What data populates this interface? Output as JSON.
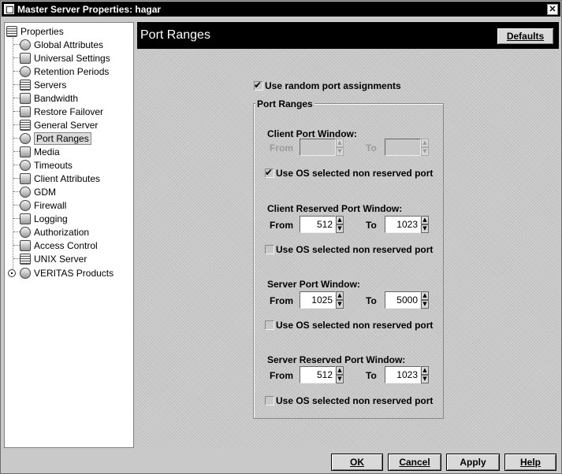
{
  "window": {
    "title": "Master Server Properties: hagar",
    "close_glyph": "✕"
  },
  "tree": {
    "items": [
      {
        "label": "Properties",
        "icon": "server-properties-icon"
      },
      {
        "label": "Global Attributes",
        "icon": "globe-icon"
      },
      {
        "label": "Universal Settings",
        "icon": "settings-icon"
      },
      {
        "label": "Retention Periods",
        "icon": "clock-icon"
      },
      {
        "label": "Servers",
        "icon": "server-icon"
      },
      {
        "label": "Bandwidth",
        "icon": "bandwidth-icon"
      },
      {
        "label": "Restore Failover",
        "icon": "failover-icon"
      },
      {
        "label": "General Server",
        "icon": "server-icon"
      },
      {
        "label": "Port Ranges",
        "icon": "port-icon"
      },
      {
        "label": "Media",
        "icon": "media-icon"
      },
      {
        "label": "Timeouts",
        "icon": "timer-icon"
      },
      {
        "label": "Client Attributes",
        "icon": "client-icon"
      },
      {
        "label": "GDM",
        "icon": "gdm-icon"
      },
      {
        "label": "Firewall",
        "icon": "firewall-icon"
      },
      {
        "label": "Logging",
        "icon": "log-icon"
      },
      {
        "label": "Authorization",
        "icon": "authorization-icon"
      },
      {
        "label": "Access Control",
        "icon": "access-control-icon"
      },
      {
        "label": "UNIX Server",
        "icon": "unix-server-icon"
      },
      {
        "label": "VERITAS Products",
        "icon": "veritas-icon"
      }
    ],
    "selected": "Port Ranges"
  },
  "header": {
    "title": "Port Ranges",
    "defaults_label": "Defaults"
  },
  "form": {
    "random_ports_label": "Use random port assignments",
    "random_ports_checked": true,
    "group_title": "Port Ranges",
    "client_port": {
      "heading": "Client Port Window:",
      "from_label": "From",
      "to_label": "To",
      "from_value": "",
      "to_value": "",
      "enabled": false,
      "os_label": "Use OS selected non reserved port",
      "os_checked": true
    },
    "client_reserved": {
      "heading": "Client Reserved Port Window:",
      "from_label": "From",
      "to_label": "To",
      "from_value": "512",
      "to_value": "1023",
      "os_label": "Use OS selected non reserved port",
      "os_checked": false
    },
    "server_port": {
      "heading": "Server Port Window:",
      "from_label": "From",
      "to_label": "To",
      "from_value": "1025",
      "to_value": "5000",
      "os_label": "Use OS selected non reserved port",
      "os_checked": false
    },
    "server_reserved": {
      "heading": "Server Reserved Port Window:",
      "from_label": "From",
      "to_label": "To",
      "from_value": "512",
      "to_value": "1023",
      "os_label": "Use OS selected non reserved port",
      "os_checked": false
    }
  },
  "buttons": {
    "ok": "OK",
    "cancel": "Cancel",
    "apply": "Apply",
    "help": "Help"
  },
  "spin_up": "▲",
  "spin_down": "▼"
}
